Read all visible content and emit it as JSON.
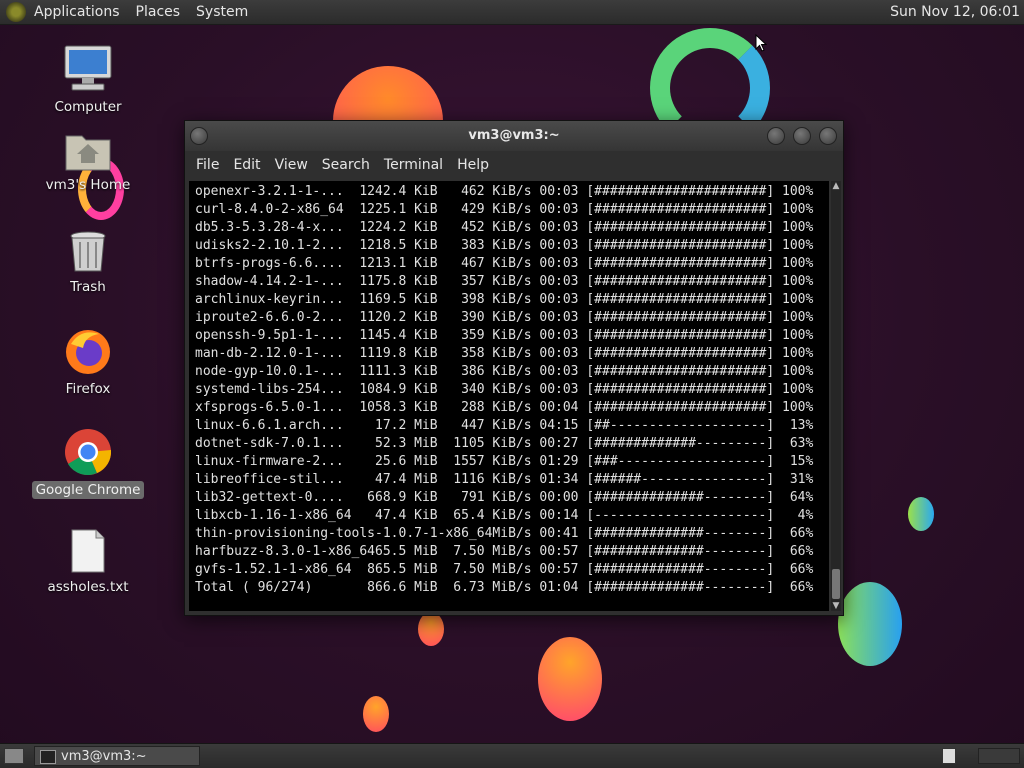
{
  "top_panel": {
    "menus": [
      "Applications",
      "Places",
      "System"
    ],
    "clock": "Sun Nov 12, 06:01"
  },
  "desktop_icons": [
    {
      "label": "Computer"
    },
    {
      "label": "vm3's Home"
    },
    {
      "label": "Trash"
    },
    {
      "label": "Firefox"
    },
    {
      "label": "Google Chrome"
    },
    {
      "label": "assholes.txt"
    }
  ],
  "terminal": {
    "title": "vm3@vm3:~",
    "menu": [
      "File",
      "Edit",
      "View",
      "Search",
      "Terminal",
      "Help"
    ],
    "lines": [
      "openexr-3.2.1-1-...  1242.4 KiB   462 KiB/s 00:03 [######################] 100%",
      "curl-8.4.0-2-x86_64  1225.1 KiB   429 KiB/s 00:03 [######################] 100%",
      "db5.3-5.3.28-4-x...  1224.2 KiB   452 KiB/s 00:03 [######################] 100%",
      "udisks2-2.10.1-2...  1218.5 KiB   383 KiB/s 00:03 [######################] 100%",
      "btrfs-progs-6.6....  1213.1 KiB   467 KiB/s 00:03 [######################] 100%",
      "shadow-4.14.2-1-...  1175.8 KiB   357 KiB/s 00:03 [######################] 100%",
      "archlinux-keyrin...  1169.5 KiB   398 KiB/s 00:03 [######################] 100%",
      "iproute2-6.6.0-2...  1120.2 KiB   390 KiB/s 00:03 [######################] 100%",
      "openssh-9.5p1-1-...  1145.4 KiB   359 KiB/s 00:03 [######################] 100%",
      "man-db-2.12.0-1-...  1119.8 KiB   358 KiB/s 00:03 [######################] 100%",
      "node-gyp-10.0.1-...  1111.3 KiB   386 KiB/s 00:03 [######################] 100%",
      "systemd-libs-254...  1084.9 KiB   340 KiB/s 00:03 [######################] 100%",
      "xfsprogs-6.5.0-1...  1058.3 KiB   288 KiB/s 00:04 [######################] 100%",
      "linux-6.6.1.arch...    17.2 MiB   447 KiB/s 04:15 [##--------------------]  13%",
      "dotnet-sdk-7.0.1...    52.3 MiB  1105 KiB/s 00:27 [#############---------]  63%",
      "linux-firmware-2...    25.6 MiB  1557 KiB/s 01:29 [###-------------------]  15%",
      "libreoffice-stil...    47.4 MiB  1116 KiB/s 01:34 [######----------------]  31%",
      "lib32-gettext-0....   668.9 KiB   791 KiB/s 00:00 [##############--------]  64%",
      "libxcb-1.16-1-x86_64   47.4 KiB  65.4 KiB/s 00:14 [----------------------]   4%",
      "thin-provisioning-tools-1.0.7-1-x86_64MiB/s 00:41 [##############--------]  66%",
      "harfbuzz-8.3.0-1-x86_6465.5 MiB  7.50 MiB/s 00:57 [##############--------]  66%",
      "gvfs-1.52.1-1-x86_64  865.5 MiB  7.50 MiB/s 00:57 [##############--------]  66%",
      "Total ( 96/274)       866.6 MiB  6.73 MiB/s 01:04 [##############--------]  66%"
    ]
  },
  "taskbar": {
    "window_button": "vm3@vm3:~"
  }
}
